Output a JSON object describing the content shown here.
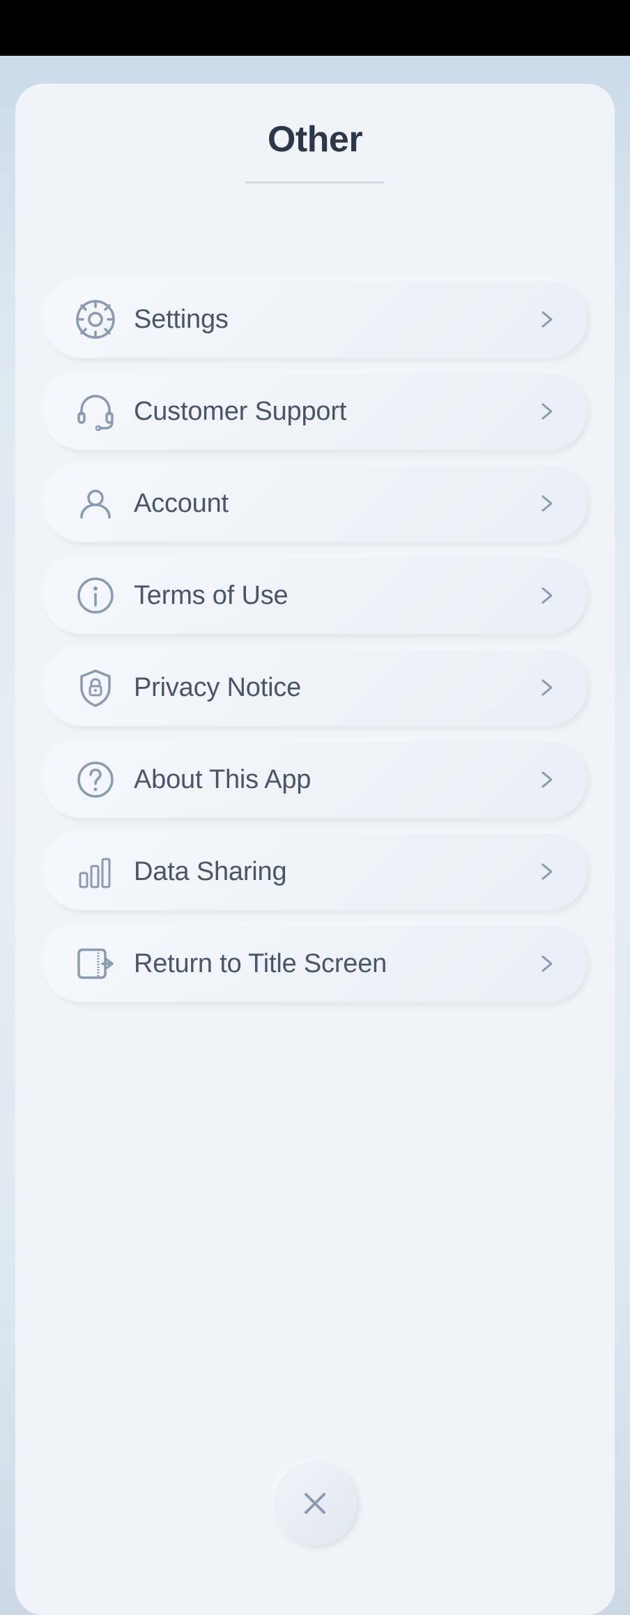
{
  "page": {
    "title": "Other",
    "background_top_bar": "#000000"
  },
  "menu": {
    "items": [
      {
        "id": "settings",
        "label": "Settings",
        "icon": "gear-icon"
      },
      {
        "id": "customer-support",
        "label": "Customer Support",
        "icon": "headset-icon"
      },
      {
        "id": "account",
        "label": "Account",
        "icon": "account-icon"
      },
      {
        "id": "terms-of-use",
        "label": "Terms of Use",
        "icon": "info-icon"
      },
      {
        "id": "privacy-notice",
        "label": "Privacy Notice",
        "icon": "shield-icon"
      },
      {
        "id": "about-this-app",
        "label": "About This App",
        "icon": "question-icon"
      },
      {
        "id": "data-sharing",
        "label": "Data Sharing",
        "icon": "chart-icon"
      },
      {
        "id": "return-to-title-screen",
        "label": "Return to Title Screen",
        "icon": "return-icon"
      }
    ]
  },
  "close_button": {
    "label": "×"
  }
}
